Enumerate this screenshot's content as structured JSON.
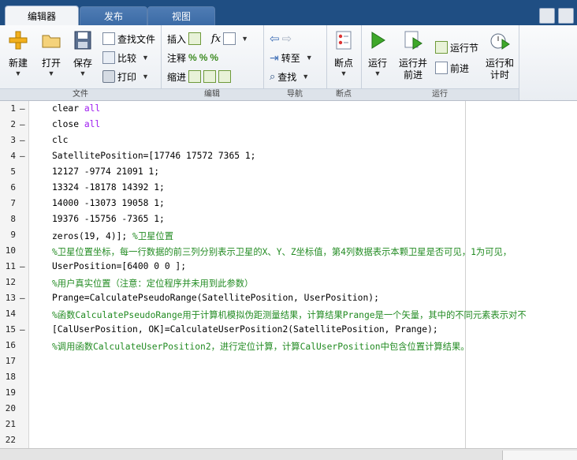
{
  "tabs": [
    {
      "label": "编辑器",
      "active": true
    },
    {
      "label": "发布",
      "active": false
    },
    {
      "label": "视图",
      "active": false
    }
  ],
  "ribbon": {
    "file_group": {
      "label": "文件",
      "new": "新建",
      "open": "打开",
      "save": "保存",
      "find_files": "查找文件",
      "compare": "比较",
      "print": "打印"
    },
    "edit_group": {
      "label": "编辑",
      "insert": "插入",
      "comment": "注释",
      "indent": "缩进",
      "fx": "fx"
    },
    "nav_group": {
      "label": "导航",
      "goto": "转至",
      "find": "查找"
    },
    "breakpoints_group": {
      "label": "断点",
      "breakpoints": "断点"
    },
    "run_group": {
      "label": "运行",
      "run": "运行",
      "run_advance_1": "运行并",
      "run_advance_2": "前进",
      "run_section": "运行节",
      "advance": "前进",
      "run_time_1": "运行和",
      "run_time_2": "计时"
    }
  },
  "editor": {
    "lines": [
      {
        "n": "1",
        "dash": "–",
        "segs": [
          {
            "t": "clear ",
            "c": ""
          },
          {
            "t": "all",
            "c": "kw"
          }
        ]
      },
      {
        "n": "2",
        "dash": "–",
        "segs": [
          {
            "t": "close ",
            "c": ""
          },
          {
            "t": "all",
            "c": "kw"
          }
        ]
      },
      {
        "n": "3",
        "dash": "–",
        "segs": [
          {
            "t": "clc",
            "c": ""
          }
        ]
      },
      {
        "n": "4",
        "dash": "–",
        "segs": [
          {
            "t": "SatellitePosition=[17746 17572 7365 1;",
            "c": ""
          }
        ]
      },
      {
        "n": "5",
        "dash": "",
        "segs": [
          {
            "t": "12127 -9774 21091 1;",
            "c": ""
          }
        ]
      },
      {
        "n": "6",
        "dash": "",
        "segs": [
          {
            "t": "13324 -18178 14392 1;",
            "c": ""
          }
        ]
      },
      {
        "n": "7",
        "dash": "",
        "segs": [
          {
            "t": "14000 -13073 19058 1;",
            "c": ""
          }
        ]
      },
      {
        "n": "8",
        "dash": "",
        "segs": [
          {
            "t": "19376 -15756 -7365 1;",
            "c": ""
          }
        ]
      },
      {
        "n": "9",
        "dash": "",
        "segs": [
          {
            "t": "zeros(19, 4)]; ",
            "c": ""
          },
          {
            "t": "%卫星位置",
            "c": "cm"
          }
        ]
      },
      {
        "n": "10",
        "dash": "",
        "segs": [
          {
            "t": "%卫星位置坐标，每一行数据的前三列分别表示卫星的X、Y、Z坐标值，第4列数据表示本颗卫星是否可见，1为可见，",
            "c": "cm"
          }
        ]
      },
      {
        "n": "11",
        "dash": "–",
        "segs": [
          {
            "t": "UserPosition=[6400 0 0 ];",
            "c": ""
          }
        ]
      },
      {
        "n": "12",
        "dash": "",
        "segs": [
          {
            "t": "%用户真实位置（注意：定位程序并未用到此参数）",
            "c": "cm"
          }
        ]
      },
      {
        "n": "13",
        "dash": "–",
        "segs": [
          {
            "t": "Prange=CalculatePseudoRange(SatellitePosition, UserPosition);",
            "c": ""
          }
        ]
      },
      {
        "n": "14",
        "dash": "",
        "segs": [
          {
            "t": "%函数CalculatePseudoRange用于计算机模拟伪距测量结果，计算结果Prange是一个矢量，其中的不同元素表示对不",
            "c": "cm"
          }
        ]
      },
      {
        "n": "15",
        "dash": "–",
        "segs": [
          {
            "t": "[CalUserPosition, OK]=CalculateUserPosition2(SatellitePosition, Prange);",
            "c": ""
          }
        ]
      },
      {
        "n": "16",
        "dash": "",
        "segs": [
          {
            "t": "%调用函数CalculateUserPosition2，进行定位计算，计算CalUserPosition中包含位置计算结果。",
            "c": "cm"
          }
        ]
      },
      {
        "n": "17",
        "dash": "",
        "segs": []
      },
      {
        "n": "18",
        "dash": "",
        "segs": []
      },
      {
        "n": "19",
        "dash": "",
        "segs": []
      },
      {
        "n": "20",
        "dash": "",
        "segs": []
      },
      {
        "n": "21",
        "dash": "",
        "segs": []
      },
      {
        "n": "22",
        "dash": "",
        "segs": []
      }
    ]
  },
  "colors": {
    "keyword": "#a020f0",
    "comment": "#228b22",
    "titlebar": "#1f4e83"
  }
}
